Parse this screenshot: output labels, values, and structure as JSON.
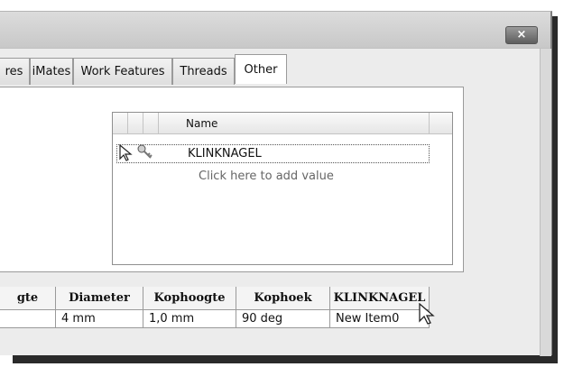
{
  "dialog": {
    "close_label": "×"
  },
  "tabs": [
    {
      "label": "res"
    },
    {
      "label": "iMates"
    },
    {
      "label": "Work Features"
    },
    {
      "label": "Threads"
    },
    {
      "label": "Other"
    }
  ],
  "active_tab": "Other",
  "grid": {
    "header": "Name",
    "rows": [
      {
        "name": "KLINKNAGEL",
        "icons": [
          "cursor-arrow-icon",
          "key-icon"
        ]
      }
    ],
    "add_value_hint": "Click here to add value"
  },
  "table": {
    "columns": [
      "gte",
      "Diameter",
      "Kophoogte",
      "Kophoek",
      "KLINKNAGEL"
    ],
    "rows": [
      [
        "",
        "4 mm",
        "1,0 mm",
        "90 deg",
        "New Item0"
      ]
    ]
  }
}
